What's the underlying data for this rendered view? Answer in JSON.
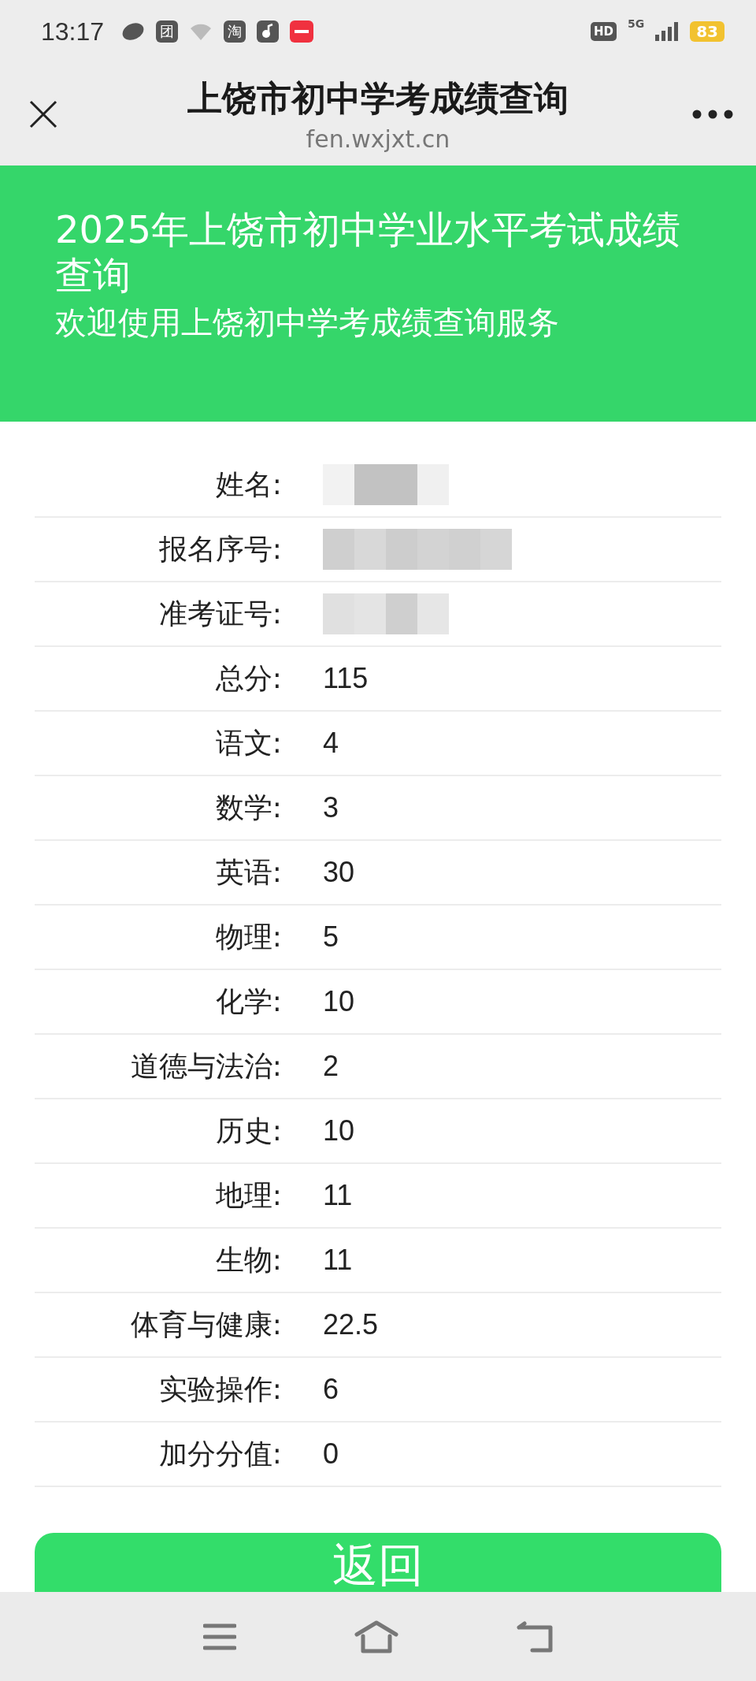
{
  "status_bar": {
    "time": "13:17",
    "notification_icons": [
      {
        "kind": "ball"
      },
      {
        "kind": "glyph",
        "text": "团"
      },
      {
        "kind": "wifi"
      },
      {
        "kind": "glyph",
        "text": "淘"
      },
      {
        "kind": "note"
      },
      {
        "kind": "red"
      }
    ],
    "hd": "HD",
    "network": "5G",
    "battery": "83"
  },
  "title_bar": {
    "title": "上饶市初中学考成绩查询",
    "url": "fen.wxjxt.cn"
  },
  "header": {
    "title": "2025年上饶市初中学业水平考试成绩查询",
    "subtitle": "欢迎使用上饶初中学考成绩查询服务"
  },
  "rows": [
    {
      "label": "姓名:",
      "redacted": true
    },
    {
      "label": "报名序号:",
      "redacted": true
    },
    {
      "label": "准考证号:",
      "redacted": true
    },
    {
      "label": "总分:",
      "value": "115",
      "redacted": false
    },
    {
      "label": "语文:",
      "value": "4",
      "redacted": false
    },
    {
      "label": "数学:",
      "value": "3",
      "redacted": false
    },
    {
      "label": "英语:",
      "value": "30",
      "redacted": false
    },
    {
      "label": "物理:",
      "value": "5",
      "redacted": false
    },
    {
      "label": "化学:",
      "value": "10",
      "redacted": false
    },
    {
      "label": "道德与法治:",
      "value": "2",
      "redacted": false
    },
    {
      "label": "历史:",
      "value": "10",
      "redacted": false
    },
    {
      "label": "地理:",
      "value": "11",
      "redacted": false
    },
    {
      "label": "生物:",
      "value": "11",
      "redacted": false
    },
    {
      "label": "体育与健康:",
      "value": "22.5",
      "redacted": false
    },
    {
      "label": "实验操作:",
      "value": "6",
      "redacted": false
    },
    {
      "label": "加分分值:",
      "value": "0",
      "redacted": false
    }
  ],
  "button": {
    "label": "返回"
  }
}
